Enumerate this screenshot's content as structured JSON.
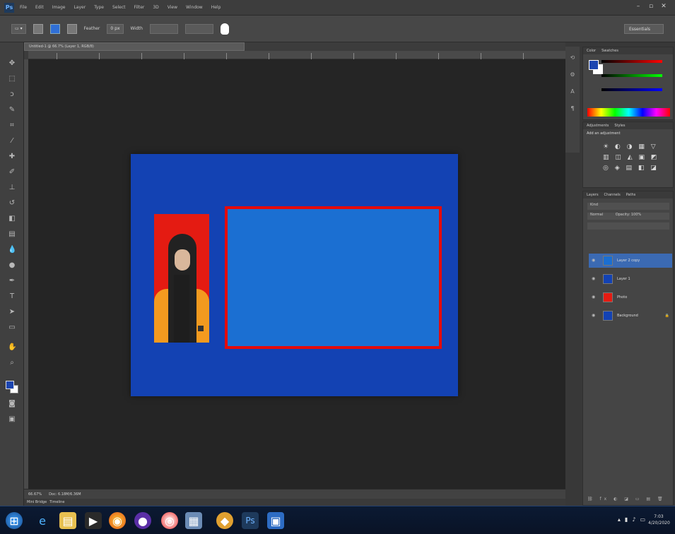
{
  "app": {
    "name": "Ps",
    "menu": [
      "File",
      "Edit",
      "Image",
      "Layer",
      "Type",
      "Select",
      "Filter",
      "3D",
      "View",
      "Window",
      "Help"
    ],
    "window_controls": [
      "–",
      "▫",
      "✕"
    ]
  },
  "options": {
    "feather_label": "Feather",
    "feather_value": "0 px",
    "width_label": "Width",
    "essentials": "Essentials"
  },
  "document": {
    "tab_title": "Untitled-1 @ 66.7% (Layer 1, RGB/8)",
    "canvas_color": "#1342b3",
    "highlight_color": "#1b6fd2",
    "highlight_border": "#e50a0a"
  },
  "status": {
    "zoom": "66.67%",
    "doc_size": "Doc: 6.18M/6.36M",
    "tabs": [
      "Mini Bridge",
      "Timeline"
    ]
  },
  "panels": {
    "color": {
      "tabs": [
        "Color",
        "Swatches"
      ]
    },
    "adjustments": {
      "tabs": [
        "Adjustments",
        "Styles"
      ],
      "subtitle": "Add an adjustment",
      "rows": [
        "☀ ◐ ◑ ▦ ▽",
        "▥ ◫ ◭ ▣ ◩",
        "◎ ◈ ▤ ◧ ◪"
      ]
    },
    "layers": {
      "tabs": [
        "Layers",
        "Channels",
        "Paths"
      ],
      "kind": "Kind",
      "blend": "Normal",
      "opacity": "Opacity: 100%",
      "items": [
        {
          "name": "Layer 2 copy",
          "selected": true,
          "thumb": "#1b6fd2"
        },
        {
          "name": "Layer 1",
          "selected": false,
          "thumb": "#1342b3"
        },
        {
          "name": "Photo",
          "selected": false,
          "thumb": "#e41b12"
        },
        {
          "name": "Background",
          "selected": false,
          "thumb": "#1342b3"
        }
      ]
    }
  },
  "taskbar": {
    "clock_time": "7:03",
    "clock_date": "4/20/2020"
  }
}
